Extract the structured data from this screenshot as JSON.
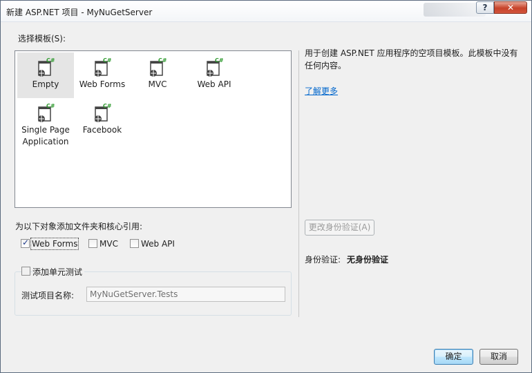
{
  "window": {
    "title": "新建 ASP.NET 项目 - MyNuGetServer",
    "help_button": "?",
    "close_button": "✕"
  },
  "templates": {
    "label": "选择模板(S):",
    "items": [
      {
        "label": "Empty",
        "icon": "web-project-csharp-icon",
        "selected": true
      },
      {
        "label": "Web Forms",
        "icon": "web-project-csharp-icon"
      },
      {
        "label": "MVC",
        "icon": "web-project-csharp-icon"
      },
      {
        "label": "Web API",
        "icon": "web-project-csharp-icon"
      },
      {
        "label": "Single Page Application",
        "icon": "web-project-csharp-icon"
      },
      {
        "label": "Facebook",
        "icon": "web-project-csharp-icon"
      }
    ]
  },
  "description": {
    "text": "用于创建 ASP.NET 应用程序的空项目模板。此模板中没有任何内容。",
    "learn_more": "了解更多"
  },
  "folders": {
    "label": "为以下对象添加文件夹和核心引用:",
    "options": [
      {
        "label": "Web Forms",
        "checked": true
      },
      {
        "label": "MVC",
        "checked": false
      },
      {
        "label": "Web API",
        "checked": false
      }
    ]
  },
  "unit_test": {
    "label": "添加单元测试",
    "checked": false,
    "name_label": "测试项目名称:",
    "name_value": "MyNuGetServer.Tests"
  },
  "auth": {
    "change_button": "更改身份验证(A)",
    "label": "身份验证:",
    "value": "无身份验证"
  },
  "footer": {
    "ok": "确定",
    "cancel": "取消"
  },
  "colors": {
    "link": "#0066cc",
    "close_button": "#c7432a",
    "csharp_badge": "#2e9a2e"
  }
}
